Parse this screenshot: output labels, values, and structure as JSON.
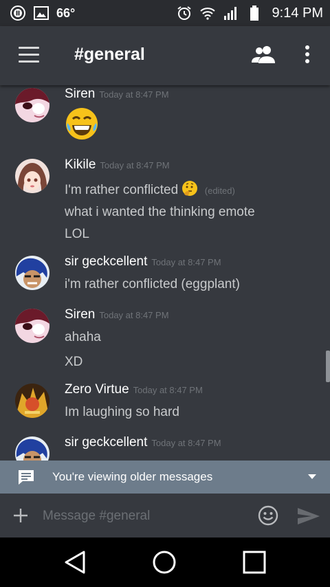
{
  "status_bar": {
    "temperature": "66°",
    "time": "9:14 PM"
  },
  "app_bar": {
    "channel": "#general",
    "icons": [
      "menu-icon",
      "members-icon",
      "more-vert-icon"
    ]
  },
  "messages": [
    {
      "author": "Siren",
      "timestamp": "Today at 8:47 PM",
      "lines": [],
      "emoji": "laughing-emoji"
    },
    {
      "author": "Kikile",
      "timestamp": "Today at 8:47 PM",
      "lines": [
        "I'm rather conflicted",
        "what i wanted the thinking emote",
        "LOL"
      ],
      "edited": "(edited)"
    },
    {
      "author": "sir geckcellent",
      "timestamp": "Today at 8:47 PM",
      "lines": [
        "i'm rather conflicted (eggplant)"
      ]
    },
    {
      "author": "Siren",
      "timestamp": "Today at 8:47 PM",
      "lines": [
        "ahaha",
        "XD"
      ]
    },
    {
      "author": "Zero Virtue",
      "timestamp": "Today at 8:47 PM",
      "lines": [
        "Im laughing so hard"
      ]
    },
    {
      "author": "sir geckcellent",
      "timestamp": "Today at 8:47 PM",
      "lines": []
    }
  ],
  "older_banner": {
    "text": "You're viewing older messages"
  },
  "composer": {
    "placeholder": "Message #general"
  },
  "colors": {
    "background": "#36393f",
    "status_bar": "#2a2c30",
    "banner": "#6d7c8b",
    "timestamp": "#6f7378"
  }
}
